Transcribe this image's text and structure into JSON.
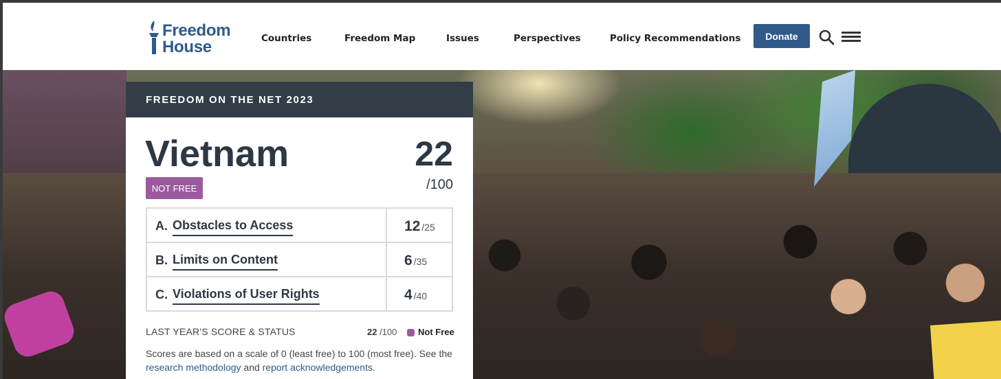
{
  "header": {
    "logo": {
      "line1": "Freedom",
      "line2": "House"
    },
    "nav": [
      "Countries",
      "Freedom Map",
      "Issues",
      "Perspectives",
      "Policy Recommendations"
    ],
    "donate_label": "Donate",
    "icons": [
      "search-icon",
      "hamburger-menu-icon"
    ],
    "brand_color": "#2f5a8a"
  },
  "card": {
    "heading": "FREEDOM ON THE NET 2023",
    "country": "Vietnam",
    "score": "22",
    "score_max": "/100",
    "status": "NOT FREE",
    "status_color": "#9b5a9e",
    "categories": [
      {
        "letter": "A.",
        "name": "Obstacles to Access",
        "score": "12",
        "max": "/25"
      },
      {
        "letter": "B.",
        "name": "Limits on Content",
        "score": "6",
        "max": "/35"
      },
      {
        "letter": "C.",
        "name": "Violations of User Rights",
        "score": "4",
        "max": "/40"
      }
    ],
    "last_year": {
      "label": "LAST YEAR'S SCORE & STATUS",
      "score": "22",
      "max": "/100",
      "status": "Not Free"
    },
    "note": {
      "text": "Scores are based on a scale of 0 (least free) to 100 (most free). See the",
      "link1": "research methodology",
      "and": "and",
      "link2": "report acknowledgements."
    }
  }
}
